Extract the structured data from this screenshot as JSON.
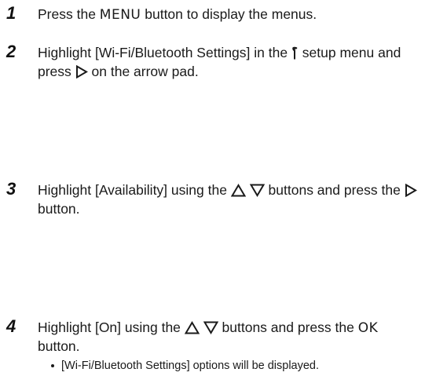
{
  "steps": [
    {
      "number": "1",
      "parts": [
        "Press the ",
        "MENU",
        " button to display the menus."
      ]
    },
    {
      "number": "2",
      "parts": [
        "Highlight [Wi-Fi/Bluetooth Settings] in the ",
        " setup menu and press ",
        " on the arrow pad."
      ]
    },
    {
      "number": "3",
      "parts": [
        "Highlight [Availability] using the ",
        " buttons and press the ",
        " button."
      ]
    },
    {
      "number": "4",
      "parts": [
        "Highlight [On] using the ",
        " buttons and press the ",
        "OK",
        " button."
      ],
      "bullets": [
        "[Wi-Fi/Bluetooth Settings] options will be displayed."
      ]
    }
  ],
  "icons": {
    "setup": "wrench-icon",
    "right": "arrow-right-icon",
    "up": "arrow-up-icon",
    "down": "arrow-down-icon"
  }
}
